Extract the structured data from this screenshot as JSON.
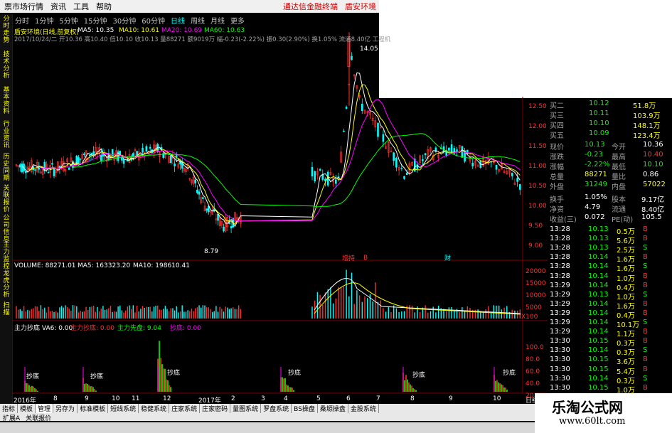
{
  "menubar": {
    "items": [
      "票市场行情",
      "资讯",
      "工具",
      "帮助"
    ],
    "right_links": [
      "通达信金融终端",
      "盾安环境"
    ]
  },
  "periodbar": {
    "items": [
      "分时",
      "1分钟",
      "5分钟",
      "15分钟",
      "30分钟",
      "60分钟",
      "日线",
      "周线",
      "月线",
      "更多"
    ],
    "active": "日线"
  },
  "left_tabs": [
    "分时走势",
    "技术分析",
    "基本资料",
    "行业资讯",
    "历史同期",
    "关联报价",
    "公司信息",
    "主力监控",
    "龙虎分析",
    "扫描"
  ],
  "price_panel": {
    "title": "盾安环境(日线,前复权)",
    "ma_labels": [
      "MA5: 10.35",
      "MA10: 10.61",
      "MA20: 10.69",
      "MA60: 10.63"
    ],
    "info_line": "2017/10/24/二 开10.36 高10.40 低10.10 收10.13 量88271 额9019万 幅-0.23(-2.22%) 振0.30(2.90%) 换1.05% 流通8.40亿 工程机",
    "high_label": "14.05",
    "low_label": "8.79",
    "y_ticks": [
      "12.50",
      "12.00",
      "11.50",
      "11.00",
      "10.50",
      "10.00",
      "9.50",
      "9.00"
    ],
    "event_labels": [
      "增持",
      "B",
      "财"
    ]
  },
  "volume_panel": {
    "labels": [
      "VOLUME: 88271.01",
      "MA5: 163323.20",
      "MA10: 198610.41"
    ],
    "y_ticks": [
      "20000",
      "15000",
      "10000",
      "5000"
    ],
    "unit": "X100"
  },
  "indicator_panel": {
    "labels": [
      "主力抄底 VA6: 0.00",
      "主力抄底: 0.00",
      "主力先盘: 9.04",
      "抄底: 0.00"
    ],
    "y_ticks": [
      "100.0",
      "80.0",
      "60.0",
      "40.0",
      "20.0"
    ],
    "annotations": [
      "抄底",
      "抄底",
      "抄底",
      "抄底",
      "抄底",
      "抄底"
    ]
  },
  "x_axis": [
    "2016年",
    "8",
    "9",
    "10",
    "11",
    "12",
    "2017年",
    "2",
    "3",
    "4",
    "5",
    "6",
    "7",
    "8",
    "9",
    "10"
  ],
  "x_axis_right": "日线",
  "quote_panel": {
    "asks": [
      {
        "label": "买二",
        "price": "10.12",
        "vol": "51.8万"
      },
      {
        "label": "买三",
        "price": "10.11",
        "vol": "103.9万"
      },
      {
        "label": "买四",
        "price": "10.10",
        "vol": "148.1万"
      },
      {
        "label": "买五",
        "price": "10.09",
        "vol": "123.4万"
      }
    ],
    "stats": [
      {
        "k1": "现价",
        "v1": "10.13",
        "k2": "今开",
        "v2": "10.36"
      },
      {
        "k1": "涨跌",
        "v1": "-0.23",
        "k2": "最高",
        "v2": "10.40"
      },
      {
        "k1": "涨幅",
        "v1": "-2.22%",
        "k2": "最低",
        "v2": "10.10"
      },
      {
        "k1": "总量",
        "v1": "88271",
        "k2": "量比",
        "v2": "0.86"
      },
      {
        "k1": "外盘",
        "v1": "31249",
        "k2": "内盘",
        "v2": "57022"
      }
    ],
    "stats2": [
      {
        "k1": "换手",
        "v1": "1.05%",
        "k2": "股本",
        "v2": "9.17亿"
      },
      {
        "k1": "净资",
        "v1": "4.79",
        "k2": "流通",
        "v2": "8.40亿"
      },
      {
        "k1": "收益(三)",
        "v1": "0.072",
        "k2": "PE(动)",
        "v2": "105.5"
      }
    ],
    "ticks": [
      {
        "t": "13:28",
        "p": "10.13",
        "v": "0.5万",
        "s": "B"
      },
      {
        "t": "13:28",
        "p": "10.13",
        "v": "5.6万",
        "s": "B"
      },
      {
        "t": "13:28",
        "p": "10.13",
        "v": "2.5万",
        "s": "S"
      },
      {
        "t": "13:28",
        "p": "10.14",
        "v": "1.6万",
        "s": "B"
      },
      {
        "t": "13:28",
        "p": "10.14",
        "v": "1.6万",
        "s": "S"
      },
      {
        "t": "13:28",
        "p": "10.14",
        "v": "1.0万",
        "s": "B"
      },
      {
        "t": "13:29",
        "p": "10.14",
        "v": "0.4万",
        "s": "B"
      },
      {
        "t": "13:29",
        "p": "10.13",
        "v": "1.0万",
        "s": "S"
      },
      {
        "t": "13:29",
        "p": "10.14",
        "v": "1.6万",
        "s": "B"
      },
      {
        "t": "13:29",
        "p": "10.14",
        "v": "0.4万",
        "s": "B"
      },
      {
        "t": "13:29",
        "p": "10.14",
        "v": "10.1万",
        "s": "S"
      },
      {
        "t": "13:29",
        "p": "10.14",
        "v": "1.1万",
        "s": "B"
      },
      {
        "t": "13:30",
        "p": "10.15",
        "v": "0.3万",
        "s": "B"
      },
      {
        "t": "13:30",
        "p": "10.14",
        "v": "0.3万",
        "s": "S"
      },
      {
        "t": "13:30",
        "p": "10.15",
        "v": "3.6万",
        "s": "B"
      },
      {
        "t": "13:30",
        "p": "10.15",
        "v": "5.4万",
        "s": "B"
      },
      {
        "t": "13:30",
        "p": "10.14",
        "v": "0.3万",
        "s": "S"
      },
      {
        "t": "13:30",
        "p": "10.15",
        "v": "1.0万",
        "s": "B"
      },
      {
        "t": "13:30",
        "p": "10.15",
        "v": "0.5万",
        "s": "B"
      }
    ]
  },
  "bottom_tabs": [
    "指标",
    "模板",
    "管理",
    "另存为",
    "标准模板",
    "短线系统",
    "稳健系统",
    "庄家系统",
    "庄家密码",
    "量图系统",
    "罗盘系统",
    "BS操盘",
    "桑塬操盘",
    "金股系统"
  ],
  "bottom_tabs_active": "管理",
  "bottom_tabs2": [
    "扩展A",
    "关联报价"
  ],
  "watermark": {
    "line1": "乐淘公式网",
    "line2": "www.60lt.com"
  },
  "colors": {
    "up": "#ff3030",
    "down": "#00ffff",
    "ma5": "#ffffff",
    "ma10": "#ffff00",
    "ma20": "#ff00ff",
    "ma60": "#00ff00",
    "border": "#800000"
  }
}
